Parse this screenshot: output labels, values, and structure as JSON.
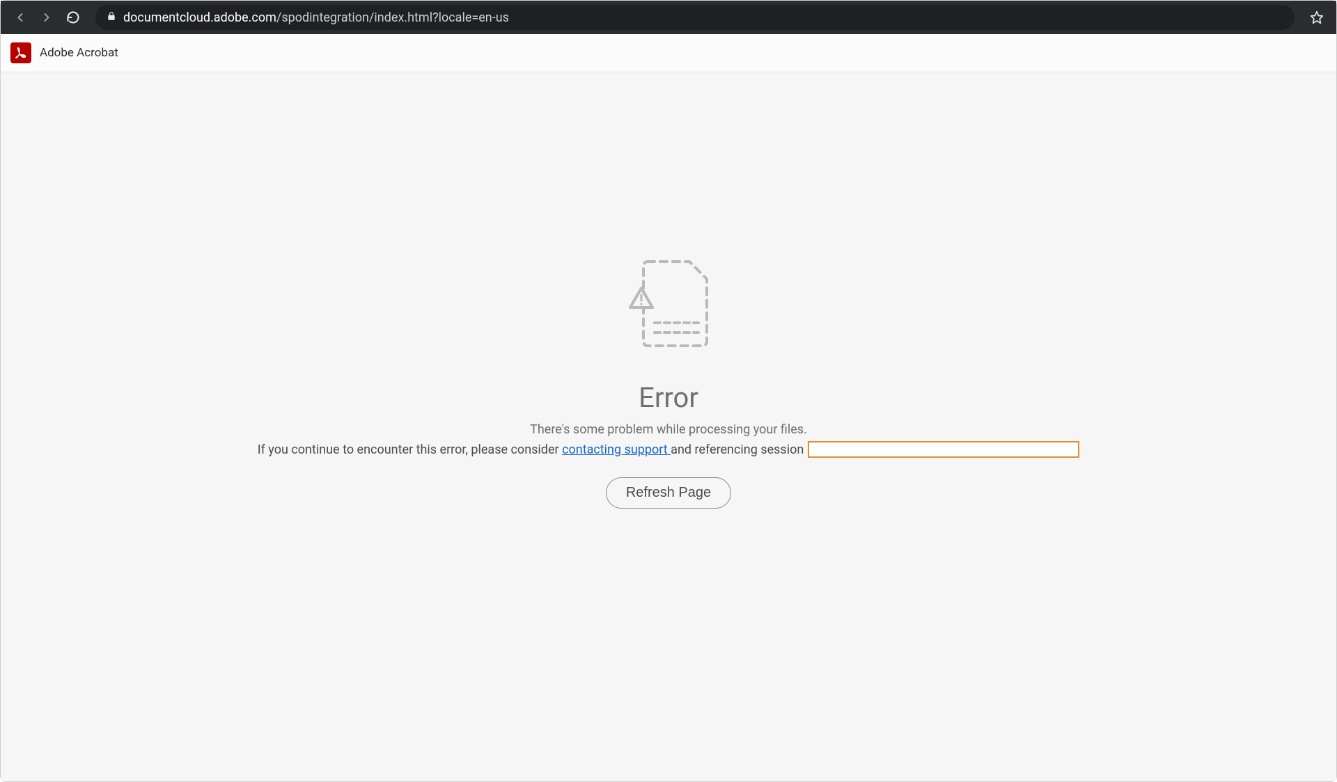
{
  "browser": {
    "url_domain": "documentcloud.adobe.com",
    "url_path": "/spodintegration/index.html?locale=en-us"
  },
  "header": {
    "title": "Adobe Acrobat"
  },
  "error": {
    "heading": "Error",
    "subtext": "There's some problem while processing your files.",
    "support_prefix": "If you continue to encounter this error, please consider ",
    "support_link": "contacting support ",
    "support_suffix": "and referencing session",
    "refresh_label": "Refresh Page"
  }
}
